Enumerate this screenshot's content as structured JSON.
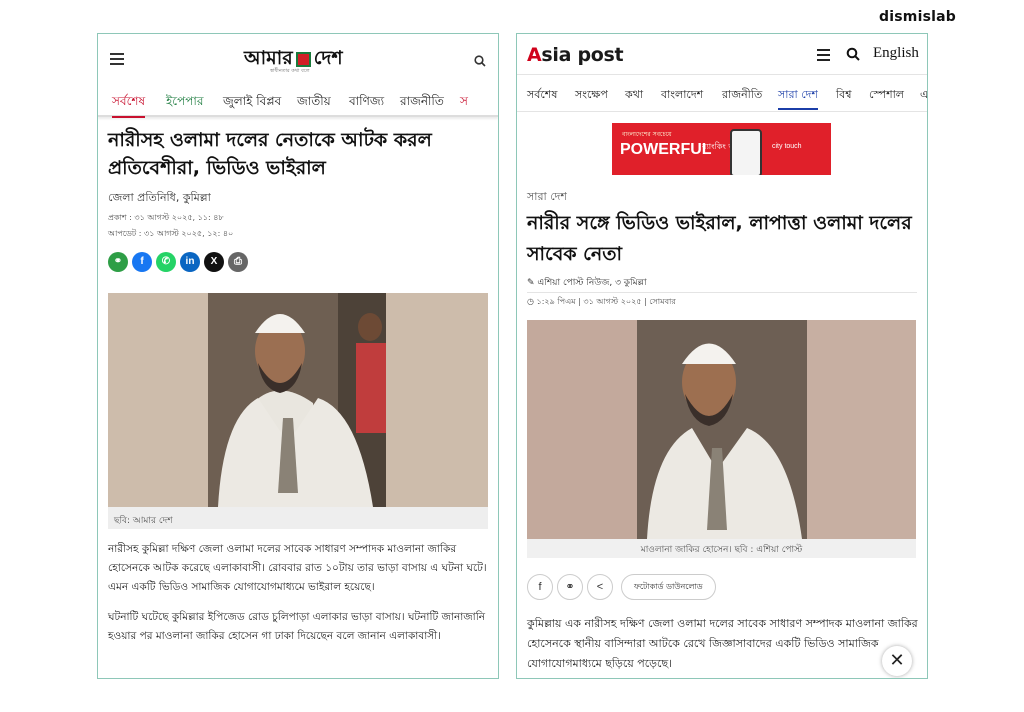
{
  "brand": "dismislab",
  "left": {
    "logo_part1": "আমার",
    "logo_part2": "দেশ",
    "logo_tagline": "স্বাধীনতার কথা বলে",
    "nav": [
      "সর্বশেষ",
      "ইপেপার",
      "জুলাই বিপ্লব",
      "জাতীয়",
      "বাণিজ্য",
      "রাজনীতি",
      "স"
    ],
    "title": "নারীসহ ওলামা দলের নেতাকে আটক করল প্রতিবেশীরা, ভিডিও ভাইরাল",
    "reporter": "জেলা প্রতিনিধি, কুমিল্লা",
    "published": "প্রকাশ : ৩১ আগস্ট ২০২৫, ১১: ৪৮",
    "updated": "আপডেট : ৩১ আগস্ট ২০২৫, ১২: ৪০",
    "share_icons": [
      "link-icon",
      "facebook-icon",
      "whatsapp-icon",
      "linkedin-icon",
      "x-icon",
      "print-icon"
    ],
    "image_caption": "ছবি: আমার দেশ",
    "para1": "নারীসহ কুমিল্লা দক্ষিণ জেলা ওলামা দলের সাবেক সাধারণ সম্পাদক মাওলানা জাকির হোসেনকে আটক করেছে এলাকাবাসী। রোববার রাত ১০টায় তার ভাড়া বাসায় এ ঘটনা ঘটে। এমন একটি ভিডিও সামাজিক যোগাযোগমাধ্যমে ভাইরাল হয়েছে।",
    "para2": "ঘটনাটি ঘটেছে কুমিল্লার ইপিজেড রোড চুলিপাড়া এলাকার ভাড়া বাসায়। ঘটনাটি জানাজানি হওয়ার পর মাওলানা জাকির হোসেন গা ঢাকা দিয়েছেন বলে জানান এলাকাবাসী।",
    "accent_color": "#c8102e"
  },
  "right": {
    "logo_a": "A",
    "logo_rest": "sia post",
    "lang": "English",
    "nav": [
      "সর্বশেষ",
      "সংক্ষেপ",
      "কথা",
      "বাংলাদেশ",
      "রাজনীতি",
      "সারা দেশ",
      "বিশ্ব",
      "স্পেশাল",
      "এ"
    ],
    "ad": {
      "top": "বাংলাদেশের সবচেয়ে",
      "headline": "POWERFUL",
      "sub": "ব্যাংকিং অ্যাপ",
      "brand": "city touch"
    },
    "category": "সারা দেশ",
    "title": "নারীর সঙ্গে ভিডিও ভাইরাল, লাপাত্তা ওলামা দলের সাবেক নেতা",
    "byline": "এশিয়া পোস্ট নিউজ, ৩ কুমিল্লা",
    "datetime": "১:২৯ পিএম | ৩১ আগস্ট ২০২৫ | সোমবার",
    "image_caption": "মাওলানা জাকির হোসেন। ছবি : এশিয়া পোস্ট",
    "photocard_button": "ফটোকার্ড ডাউনলোড",
    "body": "কুমিল্লায় এক নারীসহ দক্ষিণ জেলা ওলামা দলের সাবেক সাধারণ সম্পাদক মাওলানা জাকির হোসেনকে স্থানীয় বাসিন্দারা আটকে রেখে জিজ্ঞাসাবাদের একটি ভিডিও সামাজিক যোগাযোগমাধ্যমে ছড়িয়ে পড়েছে।",
    "close_glyph": "✕",
    "accent_color": "#1b3ea8"
  }
}
